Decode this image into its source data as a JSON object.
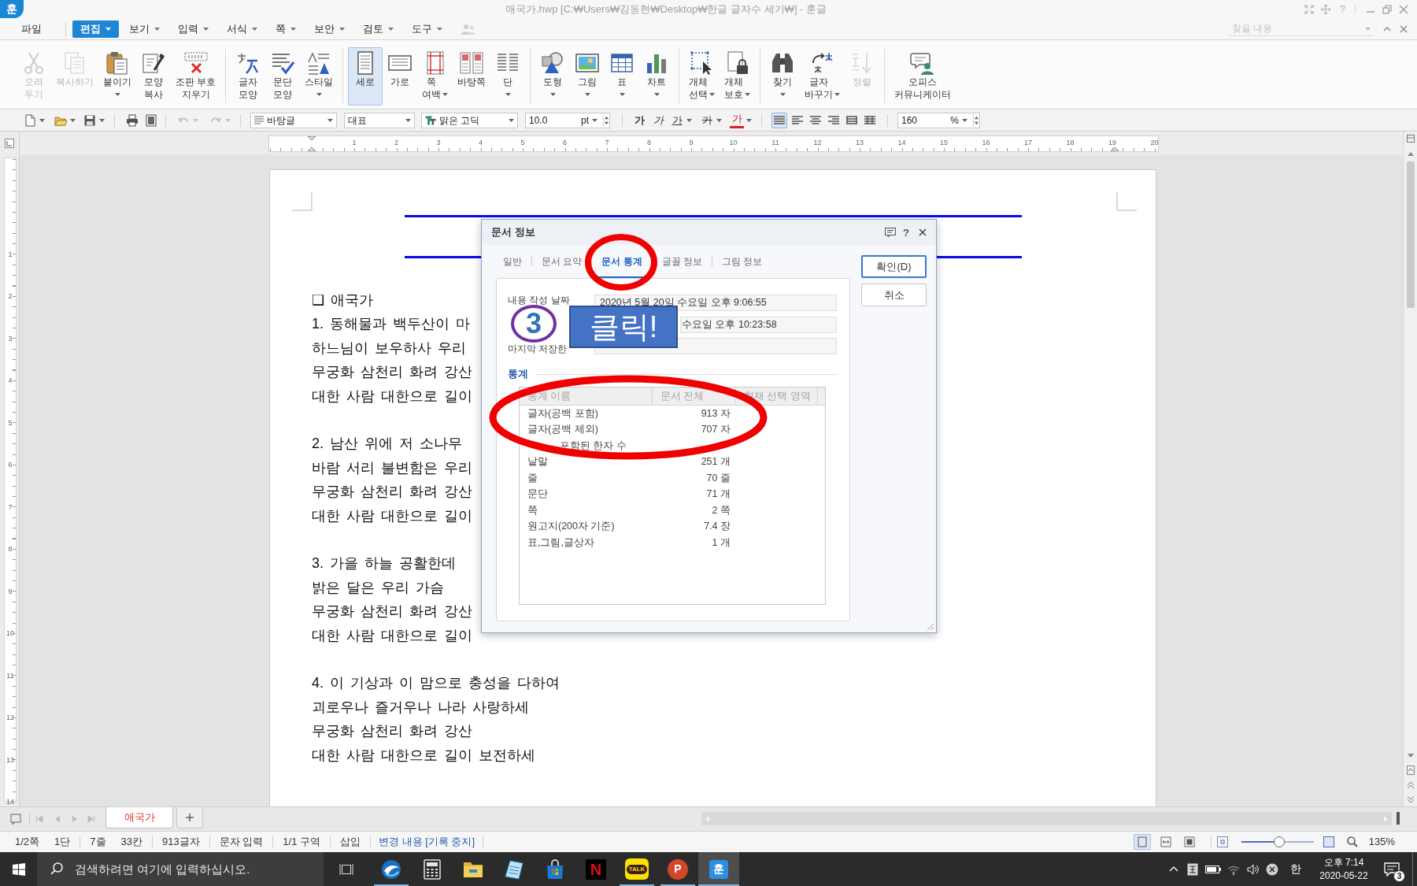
{
  "window": {
    "logo": "훈",
    "title": "애국가.hwp [C:₩Users₩김동현₩Desktop₩한글 글자수 세기₩] - 훈글",
    "help": "?"
  },
  "menu": [
    {
      "label": "파일",
      "selected": false,
      "dropdown": false
    },
    {
      "label": "편집",
      "selected": true,
      "dropdown": true
    },
    {
      "label": "보기",
      "selected": false,
      "dropdown": true
    },
    {
      "label": "입력",
      "selected": false,
      "dropdown": true
    },
    {
      "label": "서식",
      "selected": false,
      "dropdown": true
    },
    {
      "label": "쪽",
      "selected": false,
      "dropdown": true
    },
    {
      "label": "보안",
      "selected": false,
      "dropdown": true
    },
    {
      "label": "검토",
      "selected": false,
      "dropdown": true
    },
    {
      "label": "도구",
      "selected": false,
      "dropdown": true
    }
  ],
  "search": {
    "placeholder": "찾을 내용"
  },
  "ribbon": [
    [
      {
        "label": "오려\n두기",
        "disabled": true,
        "selected": false,
        "dropdown": false
      },
      {
        "label": "복사하기",
        "disabled": true,
        "selected": false,
        "dropdown": false
      },
      {
        "label": "붙이기",
        "disabled": false,
        "selected": false,
        "dropdown": true
      },
      {
        "label": "모양\n복사",
        "disabled": false,
        "selected": false,
        "dropdown": false
      },
      {
        "label": "조판 부호\n지우기",
        "disabled": false,
        "selected": false,
        "dropdown": false
      }
    ],
    [
      {
        "label": "글자\n모양",
        "disabled": false,
        "selected": false,
        "dropdown": false
      },
      {
        "label": "문단\n모양",
        "disabled": false,
        "selected": false,
        "dropdown": false
      },
      {
        "label": "스타일",
        "disabled": false,
        "selected": false,
        "dropdown": true
      }
    ],
    [
      {
        "label": "세로",
        "disabled": false,
        "selected": true,
        "dropdown": false
      },
      {
        "label": "가로",
        "disabled": false,
        "selected": false,
        "dropdown": false
      },
      {
        "label": "쪽\n여백",
        "disabled": false,
        "selected": false,
        "dropdown": true
      },
      {
        "label": "바탕쪽",
        "disabled": false,
        "selected": false,
        "dropdown": false
      },
      {
        "label": "단",
        "disabled": false,
        "selected": false,
        "dropdown": true
      }
    ],
    [
      {
        "label": "도형",
        "disabled": false,
        "selected": false,
        "dropdown": true
      },
      {
        "label": "그림",
        "disabled": false,
        "selected": false,
        "dropdown": true
      },
      {
        "label": "표",
        "disabled": false,
        "selected": false,
        "dropdown": true
      },
      {
        "label": "차트",
        "disabled": false,
        "selected": false,
        "dropdown": true
      }
    ],
    [
      {
        "label": "개체\n선택",
        "disabled": false,
        "selected": false,
        "dropdown": true
      },
      {
        "label": "개체\n보호",
        "disabled": false,
        "selected": false,
        "dropdown": true
      }
    ],
    [
      {
        "label": "찾기",
        "disabled": false,
        "selected": false,
        "dropdown": true
      },
      {
        "label": "글자\n바꾸기",
        "disabled": false,
        "selected": false,
        "dropdown": true
      },
      {
        "label": "정렬",
        "disabled": true,
        "selected": false,
        "dropdown": false
      }
    ],
    [
      {
        "label": "오피스\n커뮤니케이터",
        "disabled": false,
        "selected": false,
        "dropdown": false
      }
    ]
  ],
  "toolbar": {
    "undo_disabled": true,
    "redo_disabled": true,
    "style": "바탕글",
    "outline": "대표",
    "font": "맑은 고딕",
    "size": "10.0",
    "size_unit": "pt",
    "format": [
      {
        "kind": "bold",
        "label": "가",
        "dropdown": false
      },
      {
        "kind": "italic",
        "label": "가",
        "dropdown": false
      },
      {
        "kind": "underline",
        "label": "가",
        "dropdown": true
      },
      {
        "kind": "strike",
        "label": "가",
        "dropdown": true
      },
      {
        "kind": "color",
        "label": "가",
        "dropdown": true
      }
    ],
    "alignments": [
      {
        "selected": true
      },
      {
        "selected": false
      },
      {
        "selected": false
      },
      {
        "selected": false
      },
      {
        "selected": false
      },
      {
        "selected": false
      }
    ],
    "zoom": "160",
    "zoom_unit": "%"
  },
  "ruler": {
    "marks": [
      "1",
      "2",
      "3",
      "4",
      "5",
      "6",
      "7",
      "8",
      "9",
      "10",
      "11",
      "12",
      "13",
      "14",
      "15",
      "16",
      "17",
      "18",
      "19",
      "20"
    ],
    "vertical_marks": [
      "1",
      "2",
      "3",
      "4",
      "5",
      "6",
      "7",
      "8",
      "9",
      "10",
      "11",
      "12",
      "13",
      "14"
    ]
  },
  "document": {
    "heading": "❑ 애국가",
    "paragraphs": [
      [
        "1. 동해물과 백두산이 마",
        "하느님이 보우하사 우리",
        "무궁화 삼천리 화려 강산",
        "대한 사람 대한으로 길이"
      ],
      [
        "2. 남산 위에 저 소나무",
        "바람 서리 불변함은 우리",
        "무궁화 삼천리 화려 강산",
        "대한 사람 대한으로 길이"
      ],
      [
        "3. 가을 하늘 공활한데",
        "밝은 달은 우리 가슴",
        "무궁화 삼천리 화려 강산",
        "대한 사람 대한으로 길이"
      ],
      [
        "4. 이 기상과 이 맘으로 충성을 다하여",
        "괴로우나 즐거우나 나라 사랑하세",
        "무궁화 삼천리 화려 강산",
        "대한 사람 대한으로 길이 보전하세"
      ]
    ]
  },
  "dialog": {
    "title": "문서 정보",
    "help": "?",
    "tabs": [
      {
        "label": "일반",
        "selected": false
      },
      {
        "label": "문서 요약",
        "selected": false
      },
      {
        "label": "문서 통계",
        "selected": true
      },
      {
        "label": "글꼴 정보",
        "selected": false
      },
      {
        "label": "그림 정보",
        "selected": false
      }
    ],
    "fields": [
      {
        "label": "내용 작성 날짜",
        "value": "2020년 5월 20일 수요일 오후 9:06:55"
      },
      {
        "value": "수요일 오후 10:23:58"
      },
      {
        "label": "마지막 저장한"
      }
    ],
    "section": "통계",
    "columns": [
      "통계 이름",
      "문서 전체",
      "현재 선택 영역"
    ],
    "rows": [
      {
        "name": "글자(공백 포함)",
        "value": "913 자"
      },
      {
        "name": "글자(공백 제외)",
        "value": "707 자"
      },
      {
        "name": "포함된 한자 수"
      },
      {
        "name": "낱말",
        "value": "251 개"
      },
      {
        "name": "줄",
        "value": "70 줄"
      },
      {
        "name": "문단",
        "value": "71 개"
      },
      {
        "name": "쪽",
        "value": "2 쪽"
      },
      {
        "name": "원고지(200자 기준)",
        "value": "7.4 장"
      },
      {
        "name": "표,그림,글상자",
        "value": "1 개"
      }
    ],
    "buttons": [
      {
        "label": "확인(D)",
        "default": true
      },
      {
        "label": "취소",
        "default": false
      }
    ]
  },
  "annotations": {
    "step": "3",
    "callout": "클릭!"
  },
  "sheet_tabs": [
    {
      "label": "애국가",
      "selected": true
    }
  ],
  "status_bar": {
    "groups": [
      [
        "1/2쪽",
        "1단"
      ],
      [
        "7줄",
        "33칸"
      ],
      [
        "913글자"
      ],
      [
        "문자 입력"
      ],
      [
        "1/1 구역"
      ],
      [
        "삽입"
      ]
    ],
    "track_changes": "변경 내용 [기록 중지]",
    "views": [
      {
        "selected": true
      },
      {
        "selected": false
      },
      {
        "selected": false
      }
    ],
    "zoom": {
      "level": 0.52,
      "reading": "135%"
    }
  },
  "taskbar": {
    "search": {
      "placeholder": "검색하려면 여기에 입력하십시오."
    },
    "apps": [
      {
        "kind": "sphere",
        "running": true,
        "selected": false
      },
      {
        "kind": "calculator",
        "running": false,
        "selected": false
      },
      {
        "kind": "folder",
        "running": false,
        "selected": false
      },
      {
        "kind": "notepad",
        "running": false,
        "selected": false
      },
      {
        "kind": "store",
        "running": false,
        "selected": false
      },
      {
        "kind": "letter-tile",
        "label": "N",
        "running": false,
        "selected": false
      },
      {
        "kind": "chat-tile",
        "label": "TALK",
        "running": true,
        "selected": false
      },
      {
        "kind": "slides",
        "label": "P",
        "running": true,
        "selected": false
      },
      {
        "kind": "hangul-tile",
        "label": "훈",
        "running": true,
        "selected": true
      }
    ],
    "ime": "한",
    "time": "오후 7:14",
    "date": "2020-05-22",
    "notifications": "3"
  }
}
